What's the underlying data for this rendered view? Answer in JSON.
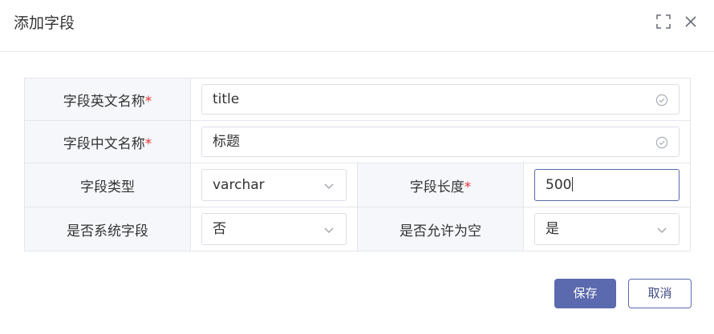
{
  "dialog": {
    "title": "添加字段",
    "icons": {
      "maximize": "maximize-icon",
      "close": "close-icon"
    }
  },
  "form": {
    "english_name": {
      "label": "字段英文名称",
      "required_mark": "*",
      "value": "title"
    },
    "chinese_name": {
      "label": "字段中文名称",
      "required_mark": "*",
      "value": "标题"
    },
    "field_type": {
      "label": "字段类型",
      "value": "varchar"
    },
    "field_length": {
      "label": "字段长度",
      "required_mark": "*",
      "value": "500"
    },
    "is_system_field": {
      "label": "是否系统字段",
      "value": "否"
    },
    "allow_null": {
      "label": "是否允许为空",
      "value": "是"
    }
  },
  "buttons": {
    "save": "保存",
    "cancel": "取消"
  },
  "colors": {
    "primary": "#5b6aae",
    "required": "#e63232",
    "label_bg": "#f5f7fa",
    "border": "#e4e6ea"
  }
}
